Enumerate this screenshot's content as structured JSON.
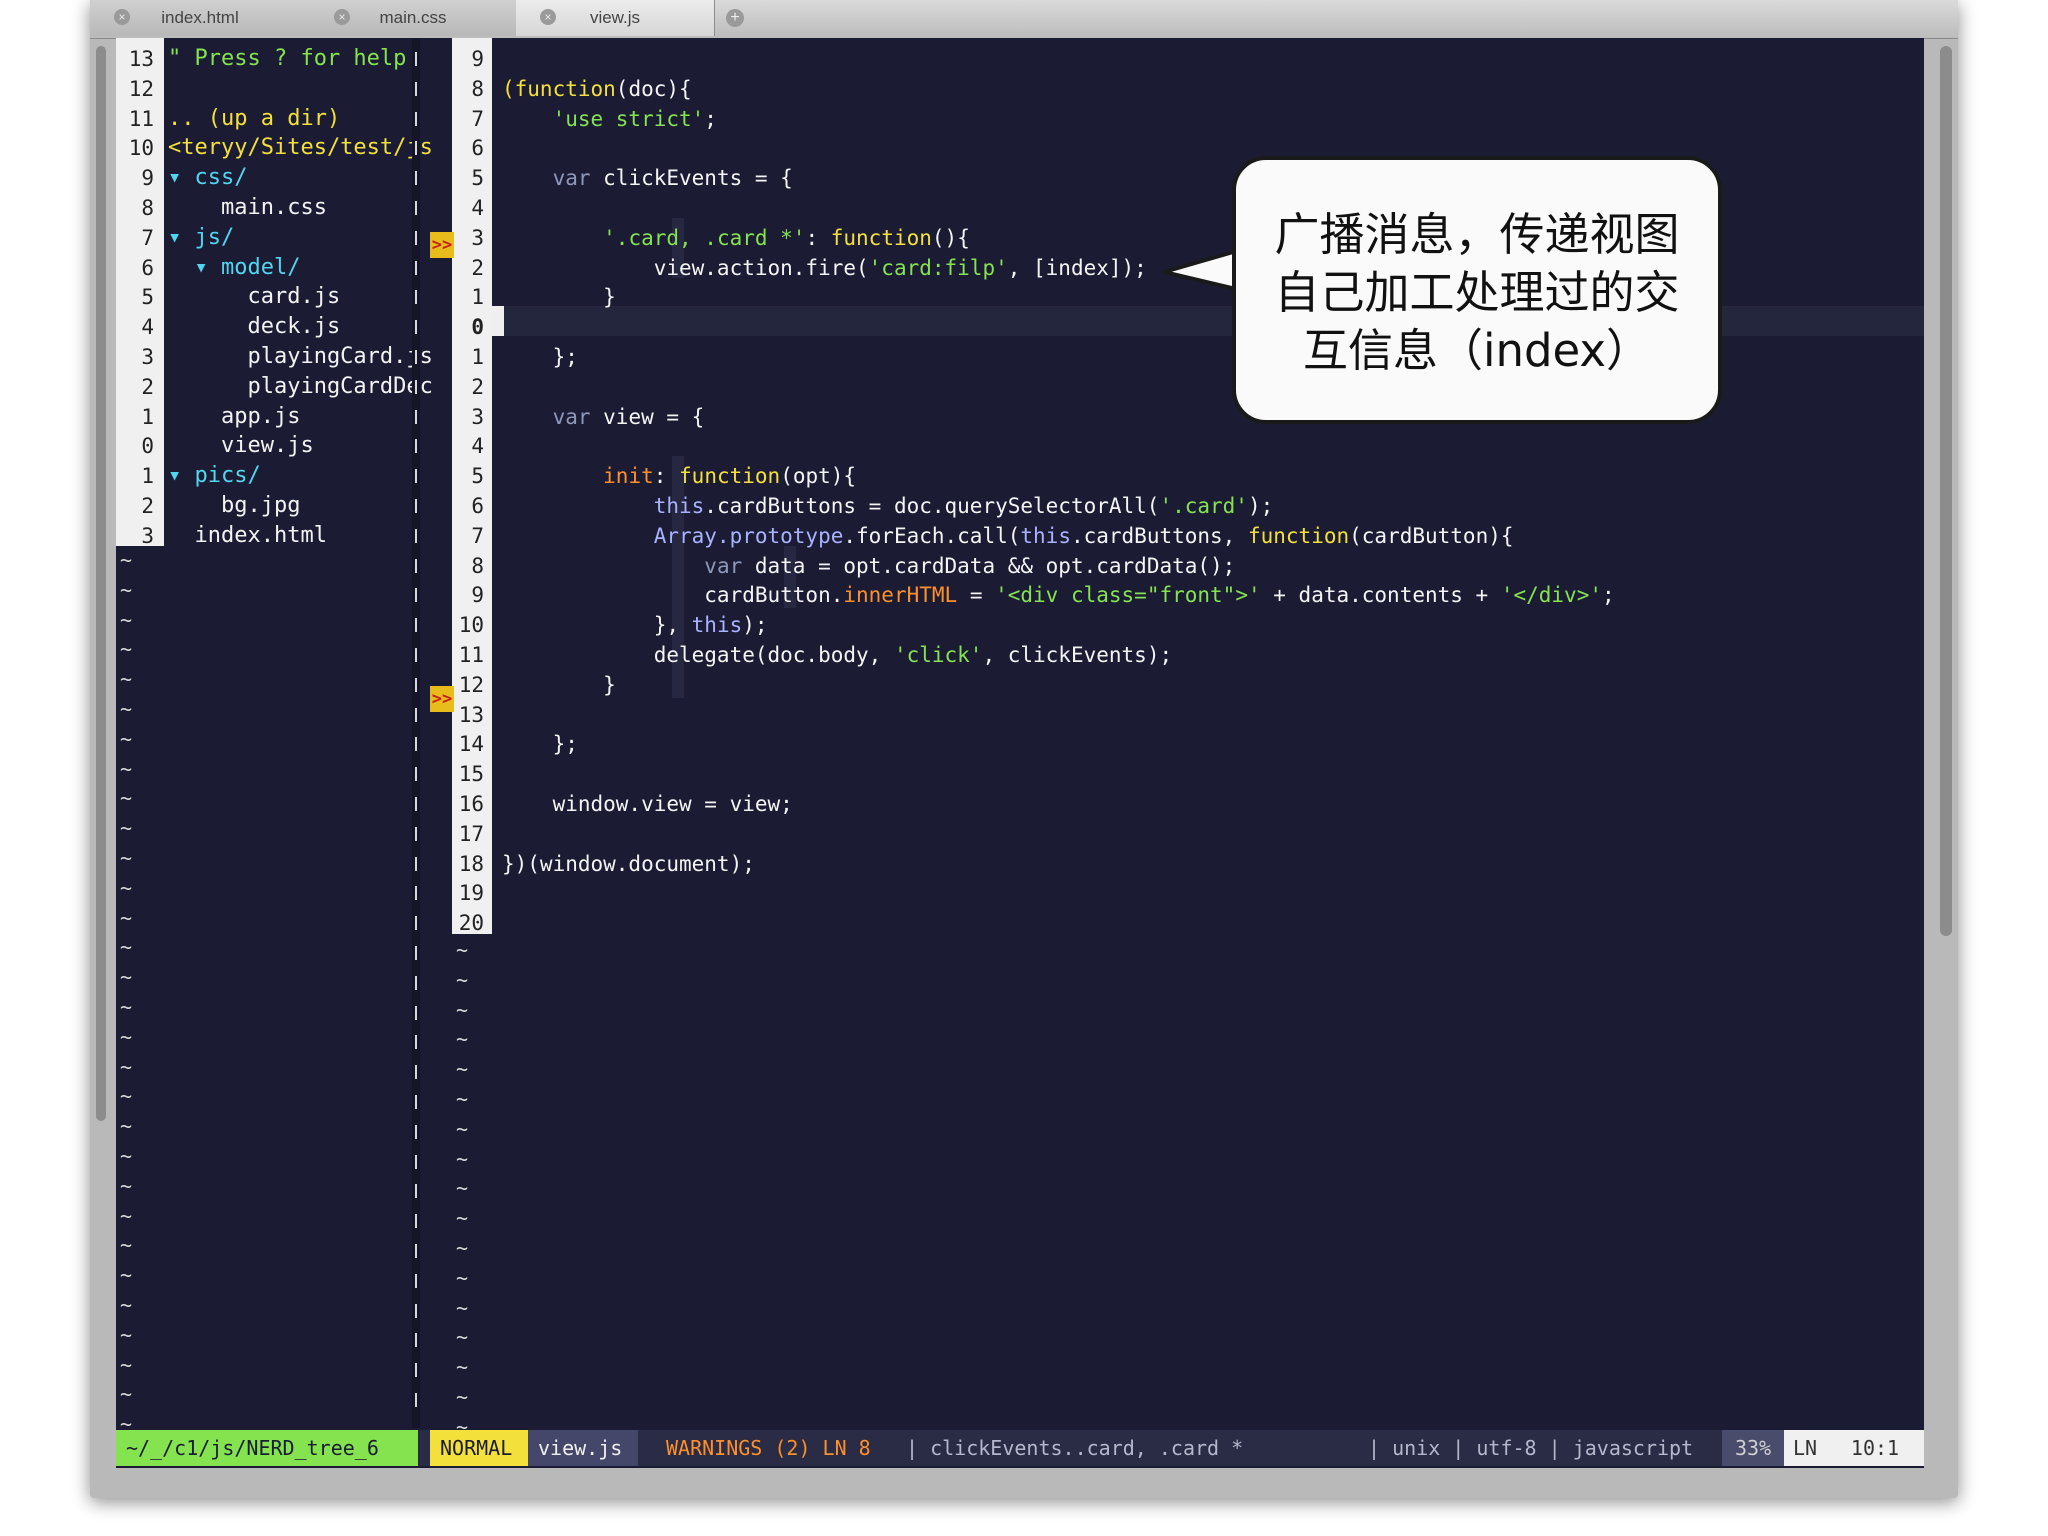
{
  "tabs": [
    {
      "label": "index.html",
      "active": false
    },
    {
      "label": "main.css",
      "active": false
    },
    {
      "label": "view.js",
      "active": true
    }
  ],
  "tree": {
    "line_numbers": [
      "13",
      "12",
      "11",
      "10",
      "9",
      "8",
      "7",
      "6",
      "5",
      "4",
      "3",
      "2",
      "1",
      "0",
      "1",
      "2",
      "3"
    ],
    "lines": [
      {
        "text": "\" Press ? for help",
        "class": "c-green"
      },
      {
        "text": "",
        "class": "c-white"
      },
      {
        "text": ".. (up a dir)",
        "class": "c-yellow"
      },
      {
        "text": "<teryy/Sites/test/js",
        "class": "c-yellow"
      },
      {
        "text": "▾ css/",
        "class": "c-cyan"
      },
      {
        "text": "    main.css",
        "class": "c-white"
      },
      {
        "text": "▾ js/",
        "class": "c-cyan"
      },
      {
        "text": "  ▾ model/",
        "class": "c-cyan"
      },
      {
        "text": "      card.js",
        "class": "c-white"
      },
      {
        "text": "      deck.js",
        "class": "c-white"
      },
      {
        "text": "      playingCard.js",
        "class": "c-white"
      },
      {
        "text": "      playingCardDec",
        "class": "c-white"
      },
      {
        "text": "    app.js",
        "class": "c-white"
      },
      {
        "text": "    view.js",
        "class": "c-white"
      },
      {
        "text": "▾ pics/",
        "class": "c-cyan"
      },
      {
        "text": "    bg.jpg",
        "class": "c-white"
      },
      {
        "text": "  index.html",
        "class": "c-white"
      }
    ]
  },
  "gutter": {
    "line_numbers": [
      "9",
      "8",
      "7",
      "6",
      "5",
      "4",
      "3",
      "2",
      "1",
      "0",
      "1",
      "2",
      "3",
      "4",
      "5",
      "6",
      "7",
      "8",
      "9",
      "10",
      "11",
      "12",
      "13",
      "14",
      "15",
      "16",
      "17",
      "18",
      "19",
      "20"
    ],
    "signs": [
      ">>",
      ">>"
    ]
  },
  "code_lines": [
    "",
    "<span class=\"fn\">(function</span>(doc){",
    "    <span class=\"str\">'use strict'</span>;",
    "",
    "    <span class=\"kw\">var</span> clickEvents = {",
    "",
    "        <span class=\"str\">'.card, .card *'</span>: <span class=\"fn\">function</span>(){",
    "            view.action.fire(<span class=\"str\">'card:filp'</span>, [index]);",
    "        }",
    "",
    "    };",
    "",
    "    <span class=\"kw\">var</span> view = {",
    "",
    "        <span class=\"prop\">init</span>: <span class=\"fn\">function</span>(opt){",
    "            <span class=\"this\">this</span>.cardButtons = doc.querySelectorAll(<span class=\"str\">'.card'</span>);",
    "            <span class=\"this\">Array.prototype</span>.forEach.call(<span class=\"this\">this</span>.cardButtons, <span class=\"fn\">function</span>(cardButton){",
    "                <span class=\"kw\">var</span> data = opt.cardData &amp;&amp; opt.cardData();",
    "                cardButton.<span class=\"prop\">innerHTML</span> = <span class=\"str\">'&lt;div class=\"front\"&gt;'</span> + data.contents + <span class=\"str\">'&lt;/div&gt;'</span>;",
    "            }, <span class=\"this\">this</span>);",
    "            delegate(doc.body, <span class=\"str\">'click'</span>, clickEvents);",
    "        }",
    "",
    "    };",
    "",
    "    window.view = view;",
    "",
    "})(window.document);",
    "",
    ""
  ],
  "status": {
    "path": "~/_/c1/js/NERD_tree_6",
    "mode": "NORMAL",
    "file": "view.js",
    "warnings": "WARNINGS (2) LN 8",
    "context": "| clickEvents..card, .card *",
    "format": "| unix | utf-8 | javascript",
    "percent": "33%",
    "ln_label": "LN",
    "position": "10:1"
  },
  "callout": {
    "lines": [
      "广播消息，传递视图",
      "自己加工处理过的交",
      "互信息（index）"
    ]
  },
  "colors": {
    "editor_bg": "#1b1c34",
    "mode_bg": "#f4e03a",
    "path_bg": "#84e34f",
    "warning": "#ff8f2a"
  }
}
